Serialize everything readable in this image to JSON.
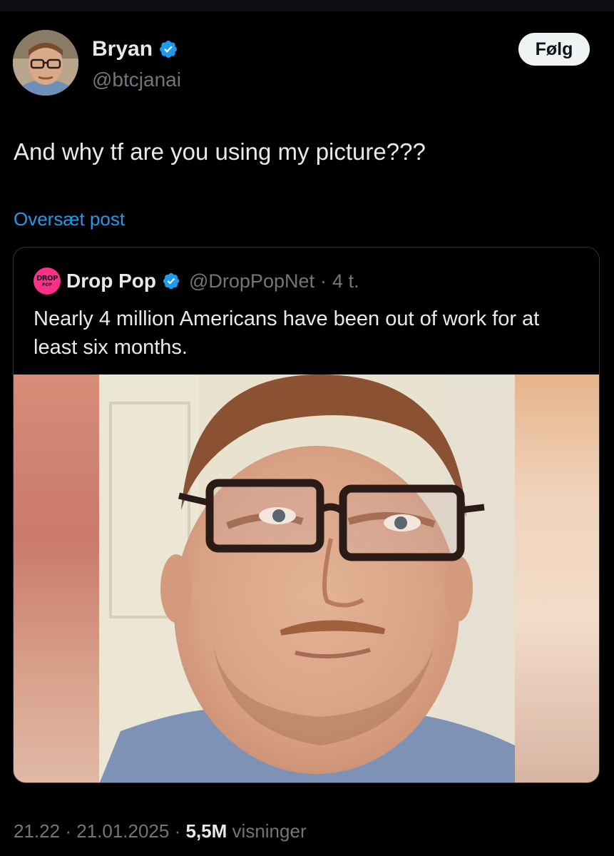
{
  "author": {
    "name": "Bryan",
    "handle": "@btcjanai",
    "verified": true
  },
  "follow_button": {
    "label": "Følg"
  },
  "post": {
    "text": "And why tf are you using my picture???",
    "translate_label": "Oversæt post"
  },
  "quoted": {
    "logo_text_top": "DROP",
    "logo_text_bottom": "POP",
    "name": "Drop Pop",
    "handle": "@DropPopNet",
    "separator": "·",
    "time": "4 t.",
    "text": "Nearly 4 million Americans have been out of work for at least six months."
  },
  "meta": {
    "time": "21.22",
    "separator": "·",
    "date": "21.01.2025",
    "views_count": "5,5M",
    "views_label": "visninger"
  },
  "colors": {
    "background": "#000000",
    "accent": "#1d9bf0",
    "text_primary": "#e7e9ea",
    "text_secondary": "#71767b",
    "border": "#2f3336",
    "brand_droppop": "#ff2e8a"
  }
}
